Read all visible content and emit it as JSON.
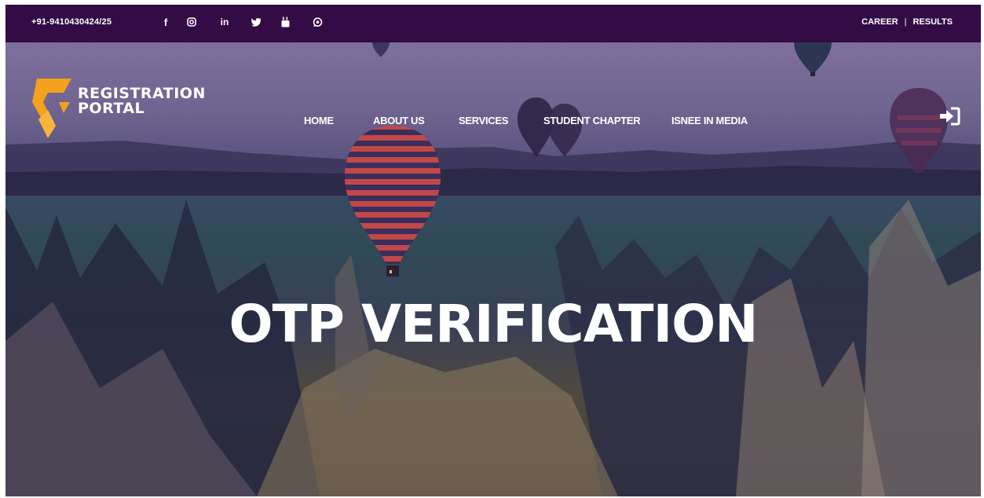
{
  "topbar": {
    "phone": "+91-9410430424/25",
    "social": [
      {
        "name": "facebook-icon",
        "glyph": "f"
      },
      {
        "name": "instagram-icon",
        "glyph": "◎"
      },
      {
        "name": "linkedin-icon",
        "glyph": "in"
      },
      {
        "name": "twitter-icon",
        "glyph": "🐦"
      },
      {
        "name": "youtube-icon",
        "glyph": "▶"
      },
      {
        "name": "whatsapp-icon",
        "glyph": "✆"
      }
    ],
    "links": {
      "career": "CAREER",
      "separator": "|",
      "results": "RESULTS"
    }
  },
  "logo": {
    "line1": "REGISTRATION",
    "line2": "PORTAL"
  },
  "nav": {
    "home": "HOME",
    "about": "ABOUT US",
    "services": "SERVICES",
    "student_chapter": "STUDENT CHAPTER",
    "media": "ISNEE IN MEDIA"
  },
  "hero": {
    "title": "OTP VERIFICATION"
  },
  "colors": {
    "topbar": "#330b45",
    "logo_orange": "#f4a11d",
    "nav_band": "#6f6490"
  }
}
